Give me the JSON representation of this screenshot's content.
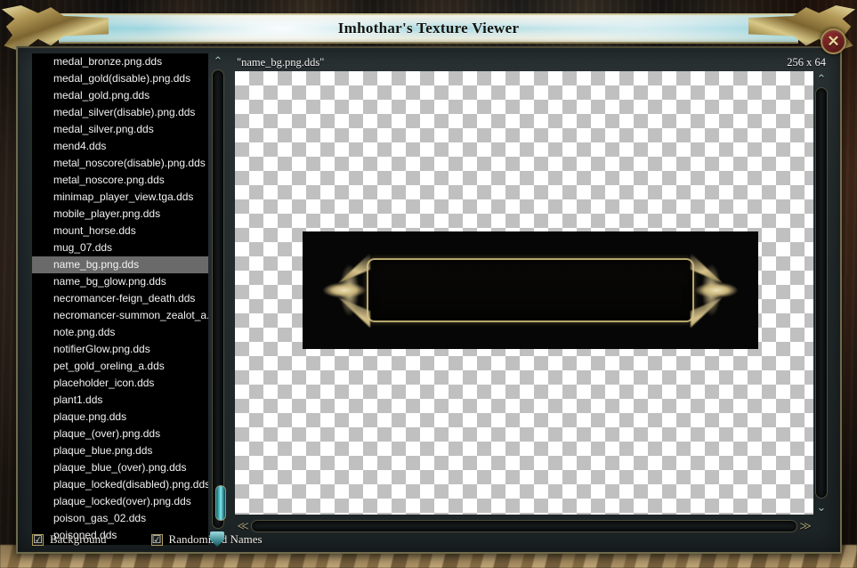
{
  "window": {
    "title": "Imhothar's Texture Viewer",
    "close_label": "✕"
  },
  "file_list": {
    "selected": "name_bg.png.dds",
    "items": [
      "medal_bronze.png.dds",
      "medal_gold(disable).png.dds",
      "medal_gold.png.dds",
      "medal_silver(disable).png.dds",
      "medal_silver.png.dds",
      "mend4.dds",
      "metal_noscore(disable).png.dds",
      "metal_noscore.png.dds",
      "minimap_player_view.tga.dds",
      "mobile_player.png.dds",
      "mount_horse.dds",
      "mug_07.dds",
      "name_bg.png.dds",
      "name_bg_glow.png.dds",
      "necromancer-feign_death.dds",
      "necromancer-summon_zealot_a.dds",
      "note.png.dds",
      "notifierGlow.png.dds",
      "pet_gold_oreling_a.dds",
      "placeholder_icon.dds",
      "plant1.dds",
      "plaque.png.dds",
      "plaque_(over).png.dds",
      "plaque_blue.png.dds",
      "plaque_blue_(over).png.dds",
      "plaque_locked(disabled).png.dds",
      "plaque_locked(over).png.dds",
      "poison_gas_02.dds",
      "poisoned.dds"
    ]
  },
  "preview": {
    "filename": "\"name_bg.png.dds\"",
    "dimensions": "256 x 64"
  },
  "scrollbars": {
    "up_arrow": "⌃",
    "down_arrow": "⌄",
    "left_arrow": "≪",
    "right_arrow": "≫"
  },
  "options": [
    {
      "label": "Background",
      "checked": true,
      "mark": "☑"
    },
    {
      "label": "Randomized Names",
      "checked": true,
      "mark": "☑"
    }
  ],
  "colors": {
    "selection": "#6a6a6a",
    "accent_teal": "#44c0c9",
    "gold": "#b8a86c",
    "checker_gray": "#c0c0c0"
  }
}
